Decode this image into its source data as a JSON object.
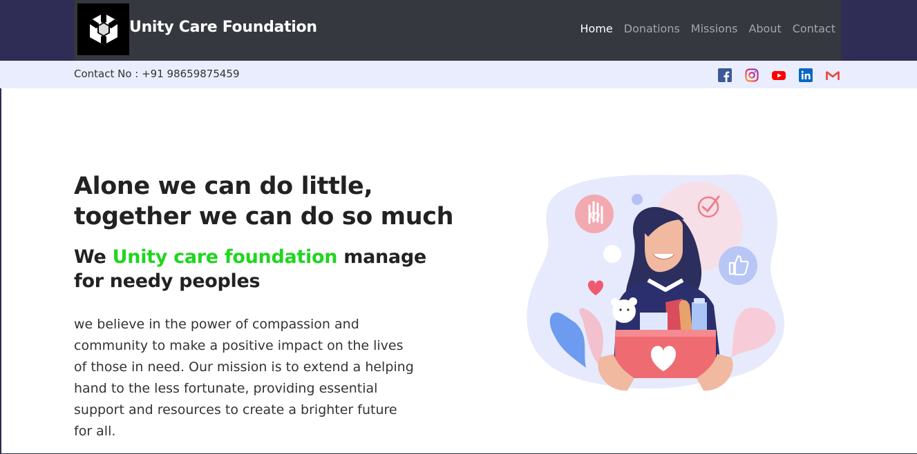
{
  "header": {
    "brand": "Unity Care Foundation",
    "nav": [
      "Home",
      "Donations",
      "Missions",
      "About",
      "Contact"
    ],
    "active_nav": "Home"
  },
  "contact_bar": {
    "contact_text": "Contact No : +91 98659875459",
    "socials": [
      "facebook-icon",
      "instagram-icon",
      "youtube-icon",
      "linkedin-icon",
      "gmail-icon"
    ]
  },
  "hero": {
    "title_line1": "Alone we can do little,",
    "title_line2": "together we can do so much",
    "sub_prefix": "We",
    "sub_highlight": "Unity care foundation",
    "sub_suffix": "manage",
    "sub_line2": "for needy peoples",
    "paragraph_lines": [
      "we believe in the power of compassion and",
      "community to make a positive impact on the lives",
      "of those in need. Our mission is to extend a helping",
      "hand to the less fortunate, providing essential",
      "support and resources to create a brighter future",
      "for all."
    ]
  },
  "colors": {
    "navbar": "#35383f",
    "topband": "#2f2c56",
    "contact_bar": "#e9edfd",
    "highlight": "#1fd61f"
  }
}
